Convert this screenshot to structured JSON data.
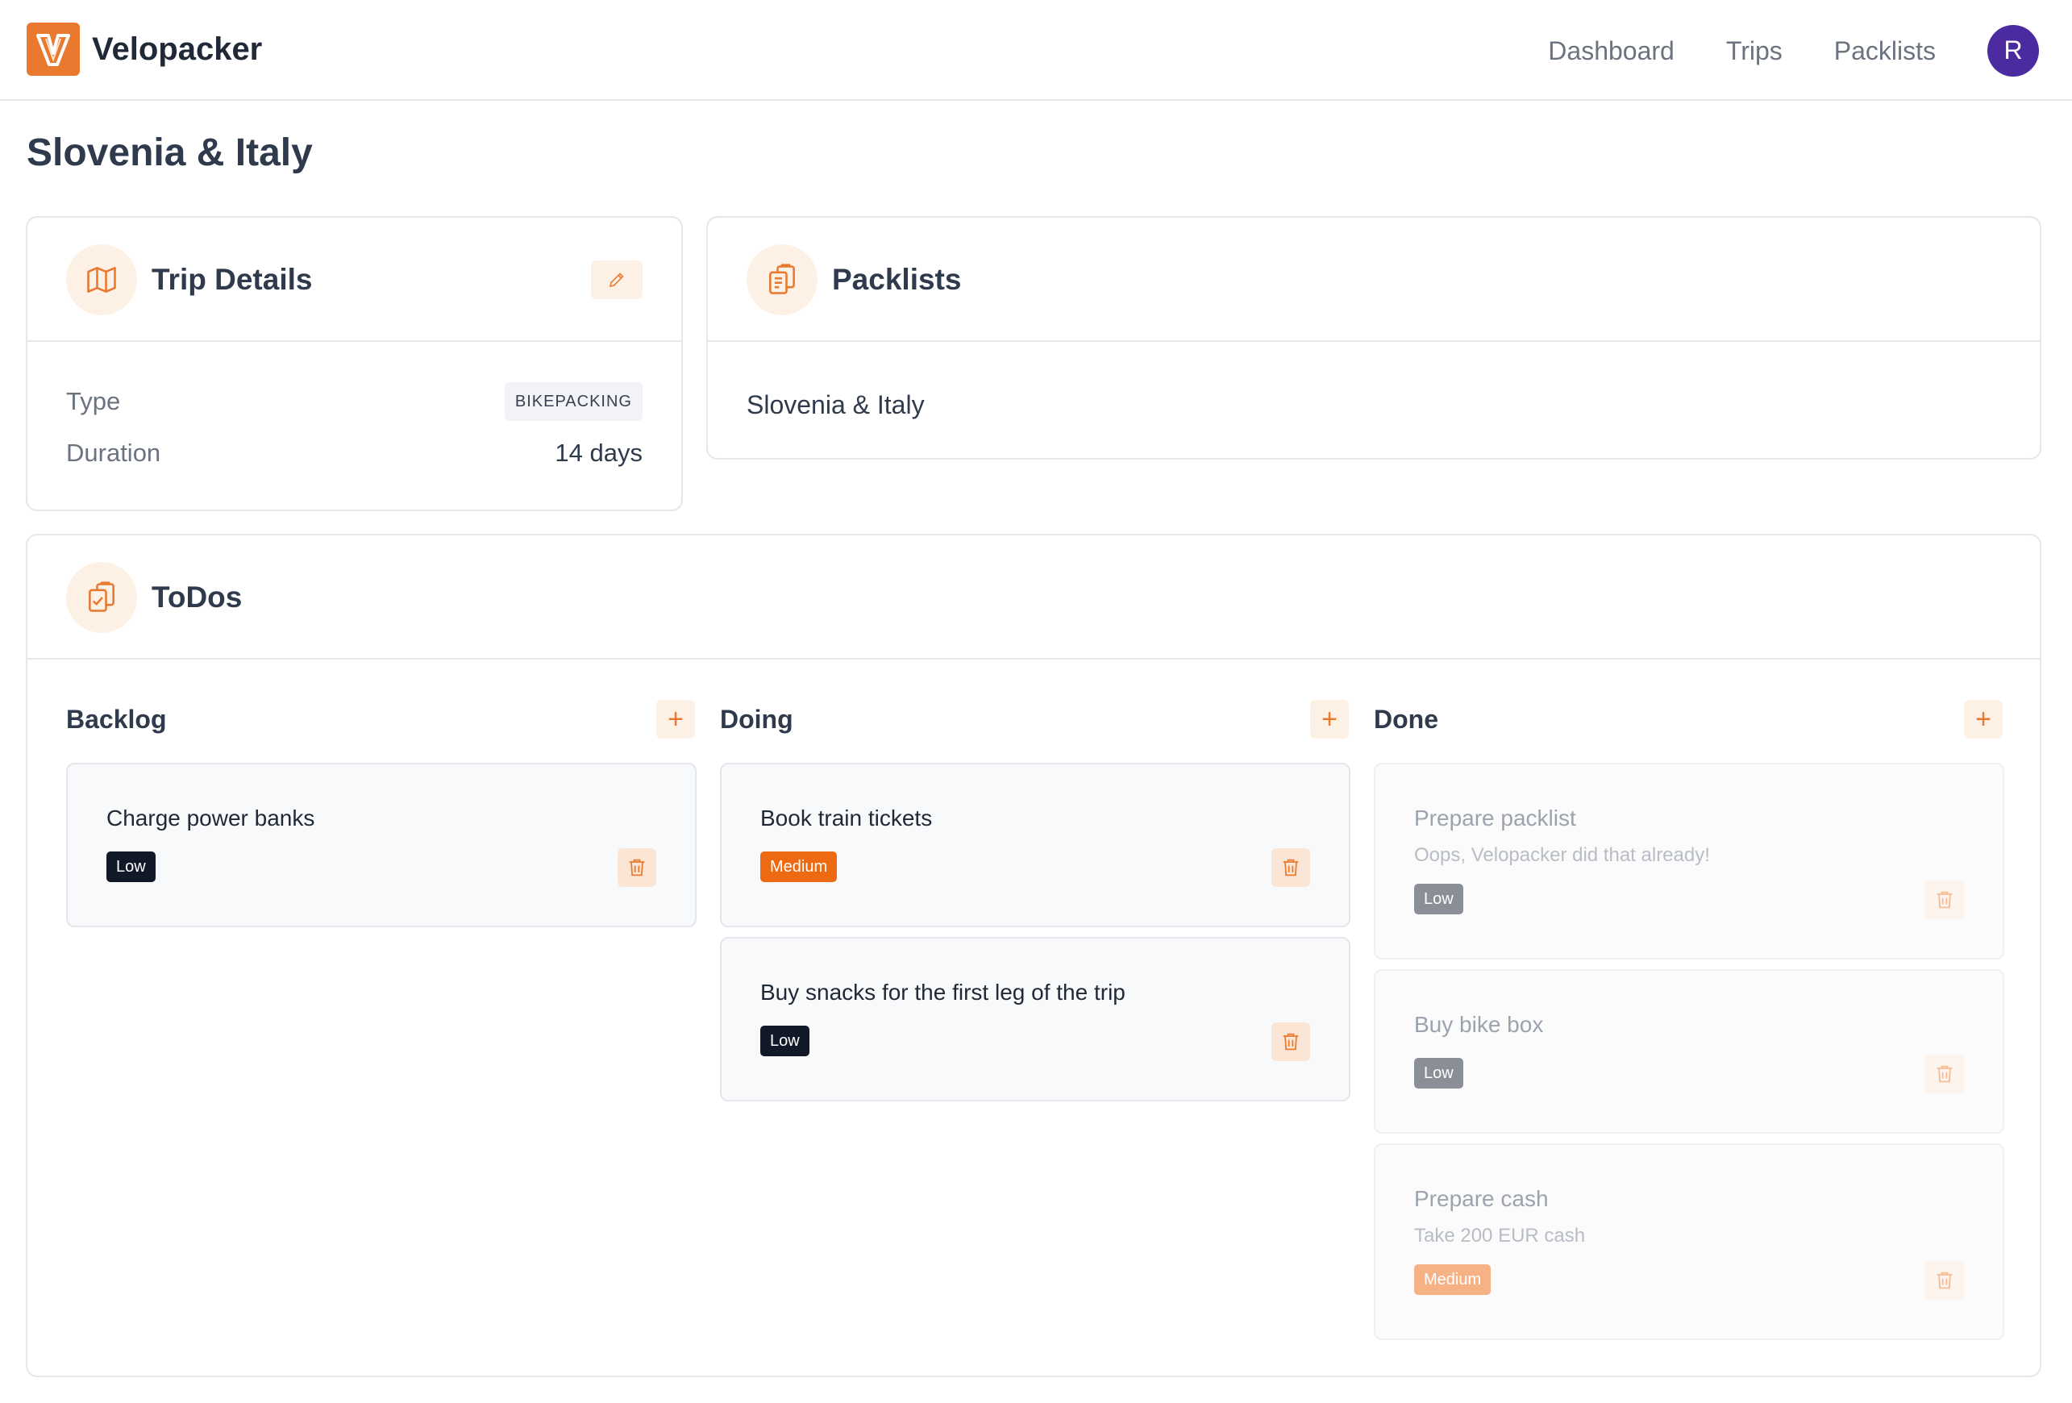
{
  "app": {
    "brand": "Velopacker",
    "logo_letter": "V",
    "nav": [
      "Dashboard",
      "Trips",
      "Packlists"
    ],
    "user_initial": "R"
  },
  "page": {
    "title": "Slovenia & Italy"
  },
  "trip_details": {
    "title": "Trip Details",
    "type_label": "Type",
    "type_value": "BIKEPACKING",
    "duration_label": "Duration",
    "duration_value": "14 days"
  },
  "packlists": {
    "title": "Packlists",
    "items": [
      "Slovenia & Italy"
    ]
  },
  "todos": {
    "title": "ToDos",
    "columns": [
      {
        "name": "Backlog",
        "tasks": [
          {
            "title": "Charge power banks",
            "priority": "Low"
          }
        ]
      },
      {
        "name": "Doing",
        "tasks": [
          {
            "title": "Book train tickets",
            "priority": "Medium"
          },
          {
            "title": "Buy snacks for the first leg of the trip",
            "priority": "Low"
          }
        ]
      },
      {
        "name": "Done",
        "tasks": [
          {
            "title": "Prepare packlist",
            "description": "Oops, Velopacker did that already!",
            "priority": "Low"
          },
          {
            "title": "Buy bike box",
            "priority": "Low"
          },
          {
            "title": "Prepare cash",
            "description": "Take 200 EUR cash",
            "priority": "Medium"
          }
        ]
      }
    ]
  },
  "colors": {
    "accent": "#e8792f",
    "accent_soft": "#fdf1e6",
    "avatar": "#4c2ba0",
    "priority_low": "#111827",
    "priority_medium": "#ed6a13"
  },
  "icons": {
    "trip_details": "map-icon",
    "packlists": "clipboard-list-icon",
    "todos": "clipboard-check-icon",
    "edit": "pencil-icon",
    "add": "plus-icon",
    "delete": "trash-icon"
  }
}
